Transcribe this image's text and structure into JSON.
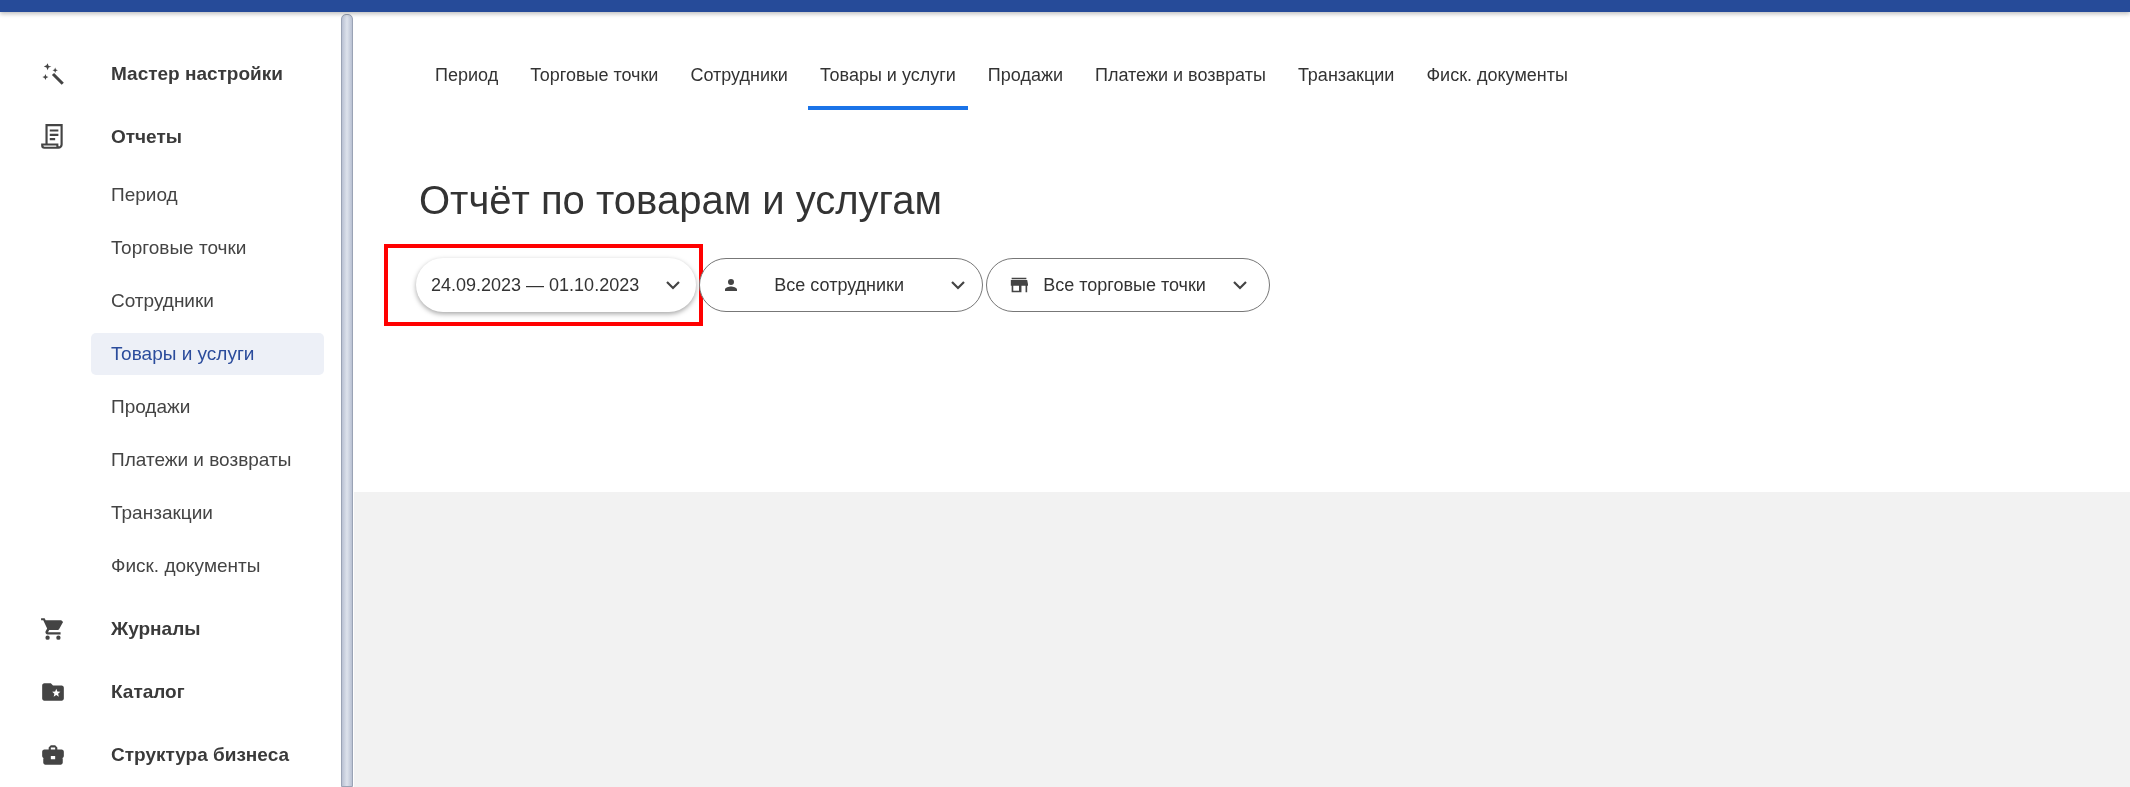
{
  "sidebar": {
    "items": [
      {
        "label": "Мастер настройки"
      },
      {
        "label": "Отчеты",
        "children": [
          {
            "label": "Период",
            "selected": false
          },
          {
            "label": "Торговые точки",
            "selected": false
          },
          {
            "label": "Сотрудники",
            "selected": false
          },
          {
            "label": "Товары и услуги",
            "selected": true
          },
          {
            "label": "Продажи",
            "selected": false
          },
          {
            "label": "Платежи и возвраты",
            "selected": false
          },
          {
            "label": "Транзакции",
            "selected": false
          },
          {
            "label": "Фиск. документы",
            "selected": false
          }
        ]
      },
      {
        "label": "Журналы"
      },
      {
        "label": "Каталог"
      },
      {
        "label": "Структура бизнеса"
      }
    ]
  },
  "tabs": [
    {
      "label": "Период",
      "selected": false
    },
    {
      "label": "Торговые точки",
      "selected": false
    },
    {
      "label": "Сотрудники",
      "selected": false
    },
    {
      "label": "Товары и услуги",
      "selected": true
    },
    {
      "label": "Продажи",
      "selected": false
    },
    {
      "label": "Платежи и возвраты",
      "selected": false
    },
    {
      "label": "Транзакции",
      "selected": false
    },
    {
      "label": "Фиск. документы",
      "selected": false
    }
  ],
  "page_title": "Отчёт по товарам и услугам",
  "filters": [
    {
      "kind": "date",
      "label": "24.09.2023 — 01.10.2023",
      "highlighted": true
    },
    {
      "kind": "employee",
      "label": "Все сотрудники",
      "highlighted": false
    },
    {
      "kind": "store",
      "label": "Все торговые точки",
      "highlighted": false
    }
  ]
}
